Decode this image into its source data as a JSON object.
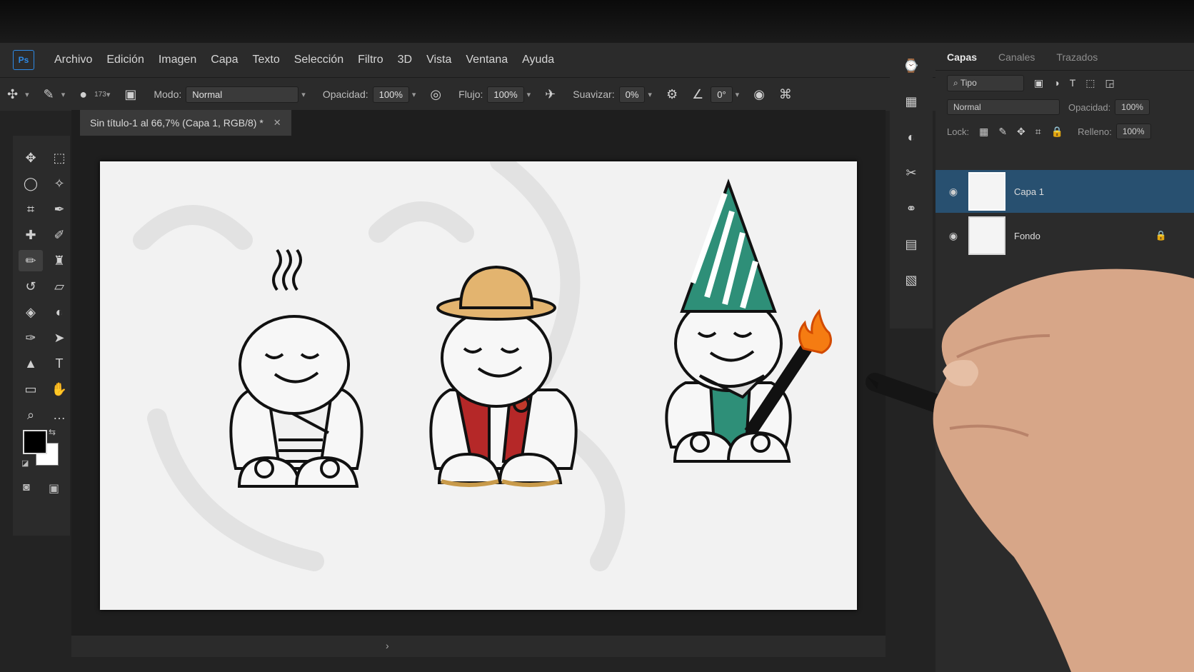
{
  "app": {
    "logo_text": "Ps",
    "menu": [
      "Archivo",
      "Edición",
      "Imagen",
      "Capa",
      "Texto",
      "Selección",
      "Filtro",
      "3D",
      "Vista",
      "Ventana",
      "Ayuda"
    ]
  },
  "options_bar": {
    "brush_size": "173",
    "mode_label": "Modo:",
    "mode_value": "Normal",
    "opacity_label": "Opacidad:",
    "opacity_value": "100%",
    "flow_label": "Flujo:",
    "flow_value": "100%",
    "smoothing_label": "Suavizar:",
    "smoothing_value": "0%",
    "angle_value": "0°"
  },
  "document": {
    "tab_title": "Sin título-1 al 66,7% (Capa 1, RGB/8) *"
  },
  "layers_panel": {
    "tabs": [
      "Capas",
      "Canales",
      "Trazados"
    ],
    "filter_placeholder": "Tipo",
    "blend_mode": "Normal",
    "opacity_label": "Opacidad:",
    "opacity_value": "100%",
    "lock_label": "Lock:",
    "fill_label": "Relleno:",
    "fill_value": "100%",
    "layers": [
      {
        "name": "Capa 1",
        "selected": true
      },
      {
        "name": "Fondo",
        "selected": false,
        "locked": true
      }
    ]
  },
  "colors": {
    "foreground": "#000000",
    "background": "#ffffff",
    "accent_selected_layer": "#285070"
  }
}
